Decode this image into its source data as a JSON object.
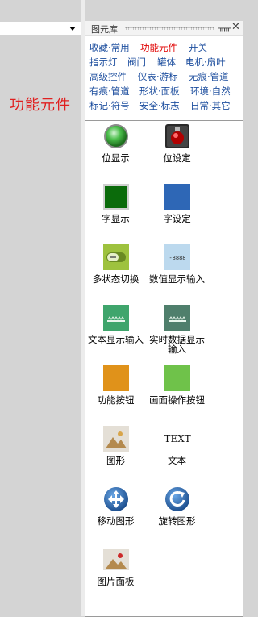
{
  "left_area": {
    "title": "功能元件"
  },
  "panel": {
    "title": "图元库",
    "pin_icon": "pin-icon",
    "close_icon": "close-icon",
    "tabs": [
      [
        "收藏·常用",
        "功能元件",
        "开关"
      ],
      [
        "指示灯",
        "阀门",
        "罐体",
        "电机·扇叶"
      ],
      [
        "高级控件",
        "仪表·游标",
        "无痕·管道"
      ],
      [
        "有痕·管道",
        "形状·面板",
        "环境·自然"
      ],
      [
        "标记·符号",
        "安全·标志",
        "日常·其它"
      ]
    ],
    "active_tab": "功能元件",
    "items": [
      {
        "label": "位显示",
        "icon": "green-indicator-icon"
      },
      {
        "label": "位设定",
        "icon": "red-button-icon"
      },
      {
        "label": "字显示",
        "icon": "green-square-icon"
      },
      {
        "label": "字设定",
        "icon": "blue-square-icon"
      },
      {
        "label": "多状态切换",
        "icon": "multistate-switch-icon"
      },
      {
        "label": "数值显示输入",
        "icon": "numeric-input-icon"
      },
      {
        "label": "文本显示输入",
        "icon": "text-input-icon"
      },
      {
        "label": "实时数据显示输入",
        "icon": "realtime-data-icon"
      },
      {
        "label": "功能按钮",
        "icon": "function-button-icon"
      },
      {
        "label": "画面操作按钮",
        "icon": "screen-button-icon"
      },
      {
        "label": "图形",
        "icon": "image-icon"
      },
      {
        "label": "文本",
        "icon": "text-icon",
        "icon_text": "TEXT"
      },
      {
        "label": "移动图形",
        "icon": "move-icon"
      },
      {
        "label": "旋转图形",
        "icon": "rotate-icon"
      },
      {
        "label": "图片面板",
        "icon": "picture-panel-icon"
      }
    ],
    "colors": {
      "active_tab": "#e00000",
      "tab": "#1d4e9e",
      "left_title": "#e02020"
    }
  }
}
